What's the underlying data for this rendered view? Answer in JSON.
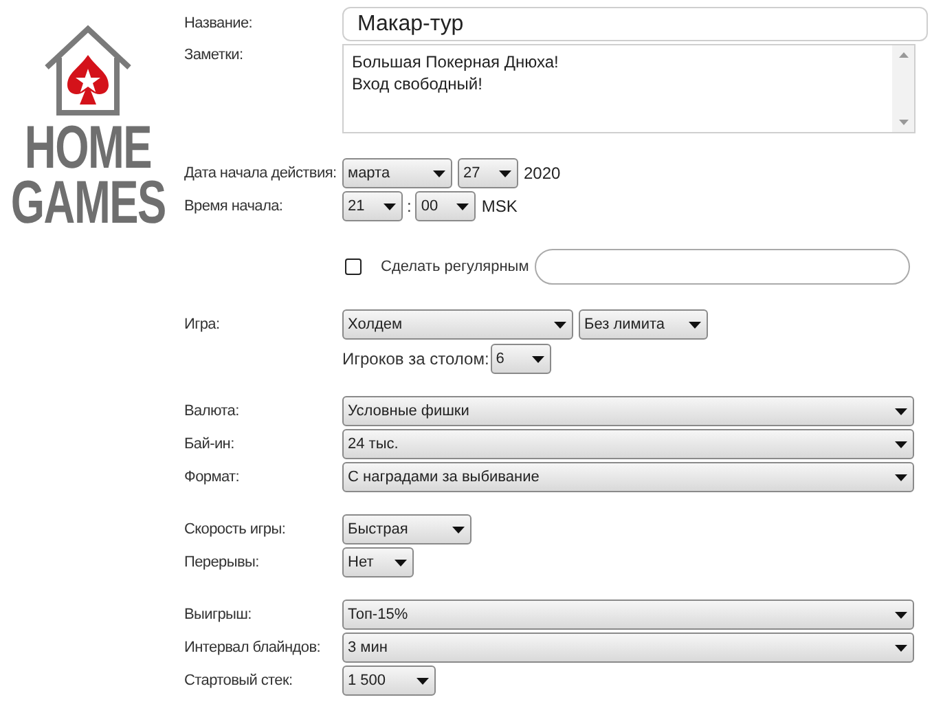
{
  "logo": {
    "line1": "HOME",
    "line2": "GAMES"
  },
  "name": {
    "label": "Название:",
    "value": "Макар-тур"
  },
  "notes": {
    "label": "Заметки:",
    "value": "Большая Покерная Днюха!\nВход свободный!"
  },
  "start_date": {
    "label": "Дата начала действия:",
    "month": "марта",
    "day": "27",
    "year": "2020"
  },
  "start_time": {
    "label": "Время начала:",
    "hour": "21",
    "separator": ":",
    "minute": "00",
    "timezone": "MSK"
  },
  "recurring": {
    "label": "Сделать регулярным",
    "checked": false
  },
  "game": {
    "label": "Игра:",
    "variant": "Холдем",
    "limit": "Без лимита",
    "players_label": "Игроков за столом:",
    "players": "6"
  },
  "groups": [
    [
      {
        "label": "Валюта:",
        "value": "Условные фишки",
        "kind": "full"
      },
      {
        "label": "Бай-ин:",
        "value": "24 тыс.",
        "kind": "full"
      },
      {
        "label": "Формат:",
        "value": "С наградами за выбивание",
        "kind": "full"
      }
    ],
    [
      {
        "label": "Скорость игры:",
        "value": "Быстрая",
        "kind": "medium"
      },
      {
        "label": "Перерывы:",
        "value": "Нет",
        "kind": "small"
      }
    ],
    [
      {
        "label": "Выигрыш:",
        "value": "Топ-15%",
        "kind": "full"
      },
      {
        "label": "Интервал блайндов:",
        "value": "3 мин",
        "kind": "full"
      },
      {
        "label": "Стартовый стек:",
        "value": "1 500",
        "kind": "mid"
      }
    ]
  ]
}
